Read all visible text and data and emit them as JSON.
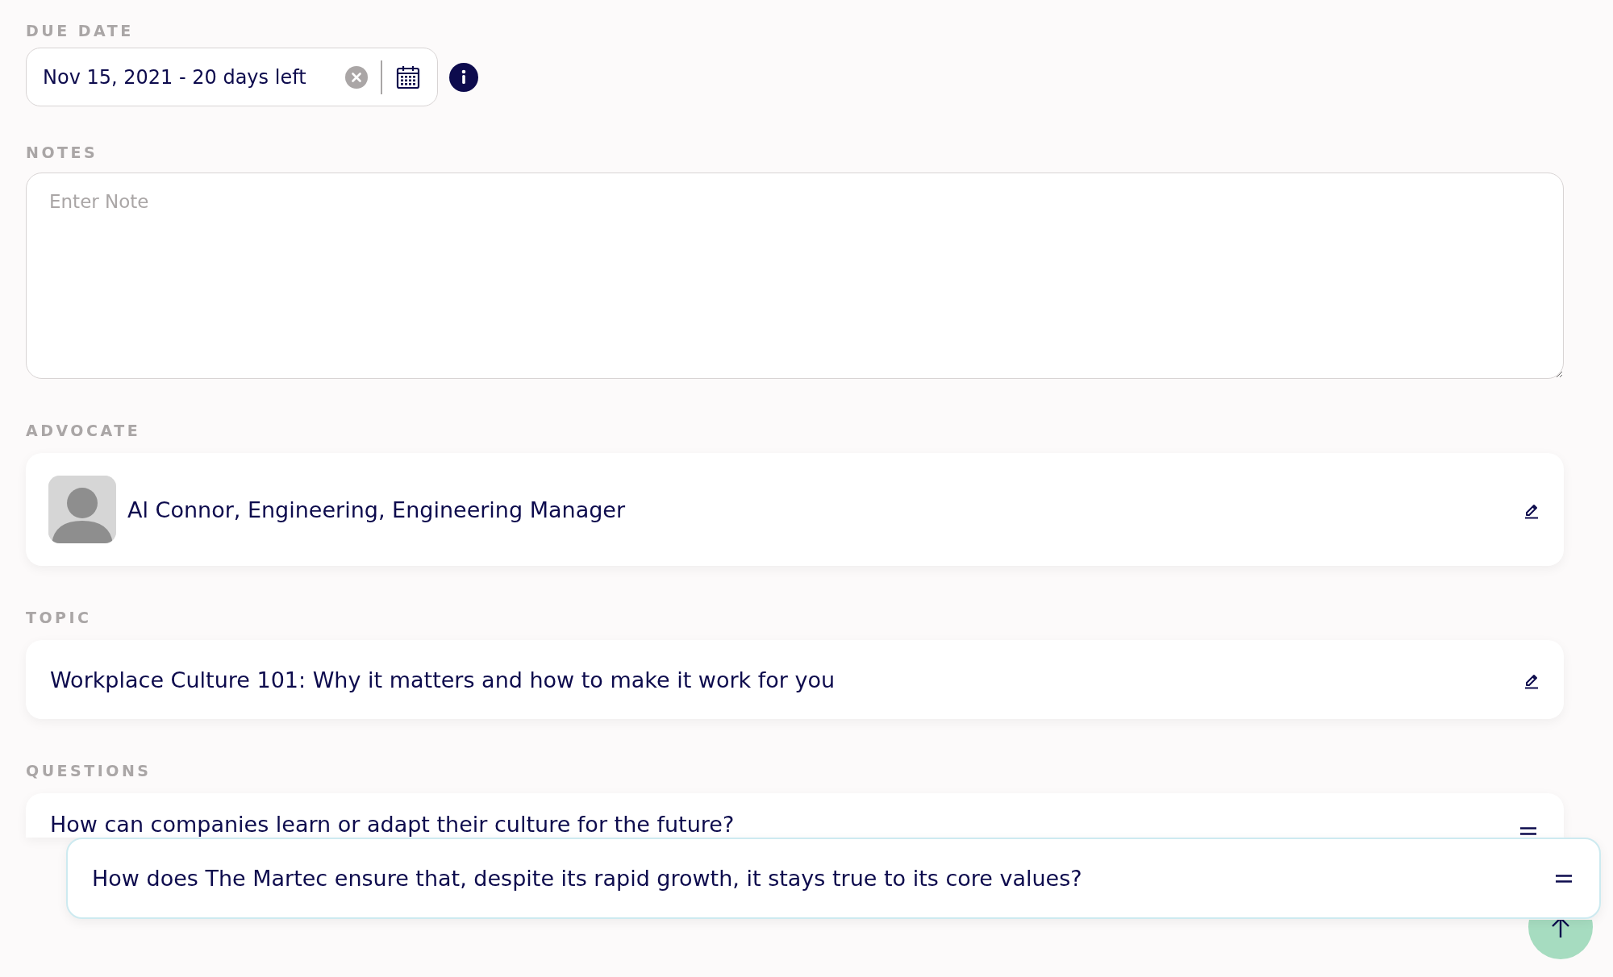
{
  "due_date": {
    "label": "DUE DATE",
    "value": "Nov 15, 2021 - 20 days left"
  },
  "notes": {
    "label": "NOTES",
    "placeholder": "Enter Note"
  },
  "advocate": {
    "label": "ADVOCATE",
    "name": "Al Connor, Engineering, Engineering Manager"
  },
  "topic": {
    "label": "TOPIC",
    "text": "Workplace Culture 101: Why it matters and how to make it work for you"
  },
  "questions": {
    "label": "QUESTIONS",
    "items": [
      {
        "text": "How can companies learn or adapt their culture for the future?",
        "dragging": false
      },
      {
        "text": "How does The Martec ensure that, despite its rapid growth, it stays true to its core values?",
        "dragging": true
      }
    ]
  }
}
